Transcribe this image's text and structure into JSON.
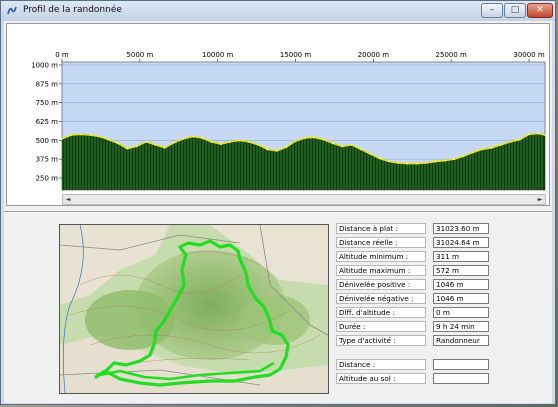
{
  "window": {
    "title": "Profil de la randonnée",
    "controls": {
      "minimize": "–",
      "maximize": "□",
      "close": "✕"
    }
  },
  "chart_data": {
    "type": "area",
    "title": "",
    "xlabel": "",
    "ylabel": "",
    "x_ticks": [
      "0 m",
      "5000 m",
      "10000 m",
      "15000 m",
      "20000 m",
      "25000 m",
      "30000 m"
    ],
    "x_tick_values": [
      0,
      5000,
      10000,
      15000,
      20000,
      25000,
      30000
    ],
    "y_ticks": [
      "1000 m",
      "875 m",
      "750 m",
      "625 m",
      "500 m",
      "375 m",
      "250 m"
    ],
    "y_tick_values": [
      1000,
      875,
      750,
      625,
      500,
      375,
      250
    ],
    "xlim": [
      0,
      31024
    ],
    "ylim": [
      170,
      1020
    ],
    "grid": true,
    "series": [
      {
        "x": [
          0,
          600,
          1200,
          1800,
          2400,
          3000,
          3600,
          4200,
          4800,
          5400,
          6000,
          6600,
          7200,
          7800,
          8400,
          9000,
          9600,
          10200,
          10800,
          11400,
          12000,
          12600,
          13200,
          13800,
          14400,
          15000,
          15600,
          16200,
          16800,
          17400,
          18000,
          18600,
          19200,
          19800,
          20400,
          21000,
          21600,
          22200,
          22800,
          23400,
          24000,
          24600,
          25200,
          25800,
          26400,
          27000,
          27600,
          28200,
          28800,
          29400,
          30000,
          30600,
          31024
        ],
        "y": [
          510,
          535,
          540,
          535,
          525,
          505,
          480,
          445,
          460,
          490,
          470,
          450,
          485,
          510,
          525,
          515,
          490,
          475,
          490,
          500,
          490,
          470,
          440,
          430,
          455,
          495,
          515,
          520,
          505,
          480,
          460,
          470,
          440,
          410,
          380,
          360,
          350,
          345,
          345,
          350,
          360,
          365,
          375,
          395,
          420,
          440,
          450,
          470,
          490,
          505,
          540,
          545,
          535
        ]
      }
    ],
    "colors": {
      "area": "#123a12",
      "area_stripe": "#3aa63a",
      "line": "#e8e020",
      "plot_bg": "#c5d9f5"
    }
  },
  "stats": [
    {
      "label": "Distance à plat :",
      "value": "31023.60 m"
    },
    {
      "label": "Distance réelle :",
      "value": "31024.64 m"
    },
    {
      "label": "Altitude minimum :",
      "value": "311 m"
    },
    {
      "label": "Altitude maximum :",
      "value": "572 m"
    },
    {
      "label": "Dénivelée positive :",
      "value": "1046 m"
    },
    {
      "label": "Dénivelée négative :",
      "value": "1046 m"
    },
    {
      "label": "Diff. d'altitude :",
      "value": "0 m"
    },
    {
      "label": "Durée :",
      "value": "9 h 24 min"
    },
    {
      "label": "Type d'activité :",
      "value": "Randonneur"
    }
  ],
  "cursor": [
    {
      "label": "Distance :",
      "value": ""
    },
    {
      "label": "Altitude au sol :",
      "value": ""
    }
  ],
  "scrollbar": {
    "left": "◄",
    "right": "►"
  },
  "map": {
    "track_color": "#22dd22"
  }
}
